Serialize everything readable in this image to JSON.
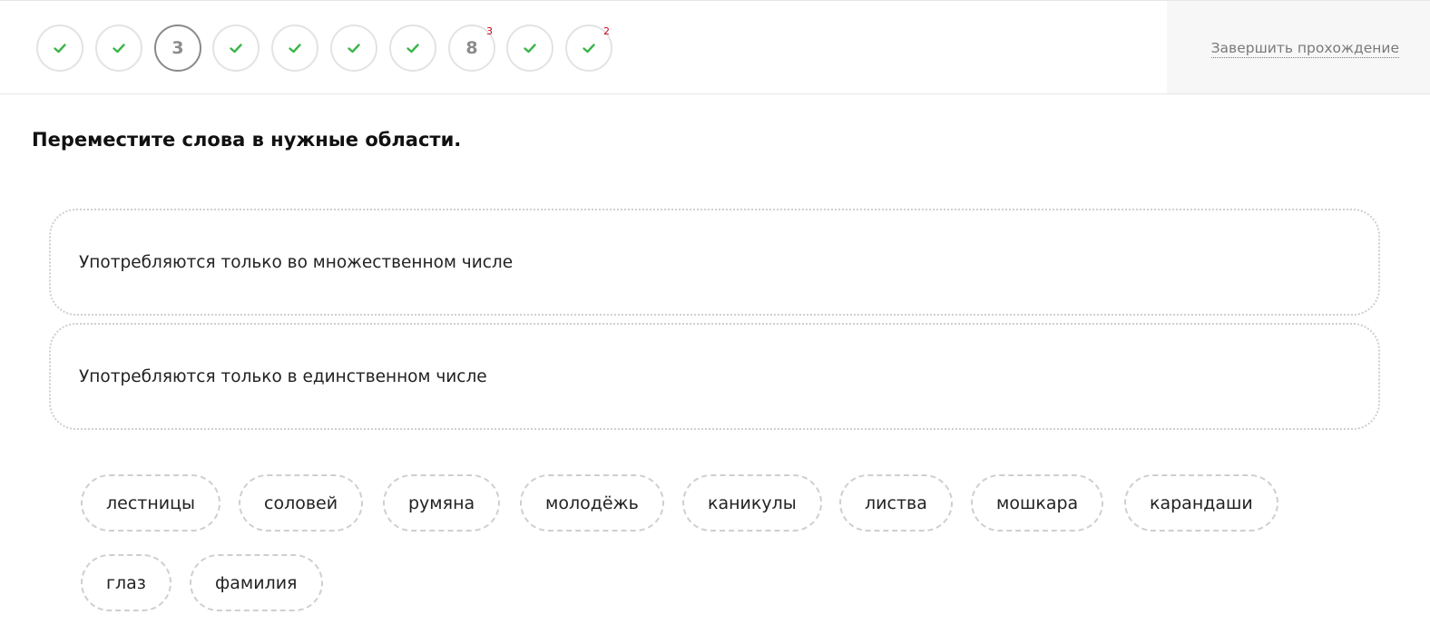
{
  "steps": [
    {
      "status": "done",
      "icon": "check-icon"
    },
    {
      "status": "done",
      "icon": "check-icon"
    },
    {
      "status": "current",
      "label": "3"
    },
    {
      "status": "done",
      "icon": "check-icon"
    },
    {
      "status": "done",
      "icon": "check-icon"
    },
    {
      "status": "done",
      "icon": "check-icon"
    },
    {
      "status": "done",
      "icon": "check-icon"
    },
    {
      "status": "pending",
      "label": "8",
      "attempts": "3"
    },
    {
      "status": "done",
      "icon": "check-icon"
    },
    {
      "status": "done",
      "icon": "check-icon",
      "attempts": "2"
    }
  ],
  "header": {
    "finish_label": "Завершить прохождение"
  },
  "question": {
    "title": "Переместите слова в нужные области."
  },
  "dropzones": [
    {
      "label": "Употребляются только во множественном числе"
    },
    {
      "label": "Употребляются только в единственном числе"
    }
  ],
  "words": [
    "лестницы",
    "соловей",
    "румяна",
    "молодёжь",
    "каникулы",
    "листва",
    "мошкара",
    "карандаши",
    "глаз",
    "фамилия"
  ],
  "colors": {
    "check": "#3bb54a",
    "attempts": "#d0021b",
    "border": "#cfcfcf"
  }
}
